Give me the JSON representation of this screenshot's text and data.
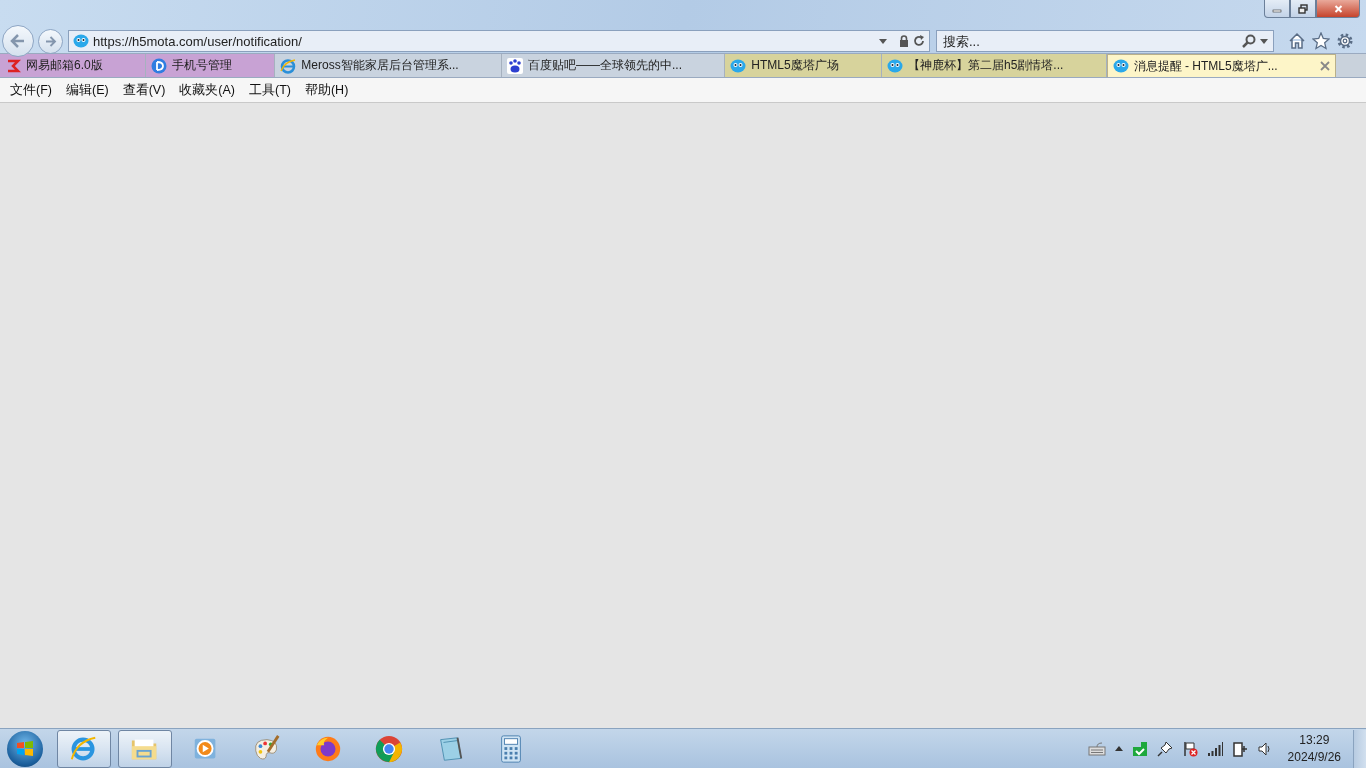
{
  "address_bar": {
    "url": "https://h5mota.com/user/notification/"
  },
  "search": {
    "placeholder": "搜索..."
  },
  "tabs": [
    {
      "label": "网易邮箱6.0版",
      "color": "#c8a2d4",
      "selected": false
    },
    {
      "label": "手机号管理",
      "color": "#c8a2d4",
      "selected": false
    },
    {
      "label": "Meross智能家居后台管理系...",
      "color": "#c9d3df",
      "selected": false
    },
    {
      "label": "百度贴吧——全球领先的中...",
      "color": "#c9d3df",
      "selected": false
    },
    {
      "label": "HTML5魔塔广场",
      "color": "#d7d39c",
      "selected": false
    },
    {
      "label": "【神鹿杯】第二届h5剧情塔...",
      "color": "#d7d39c",
      "selected": false
    },
    {
      "label": "消息提醒 - HTML5魔塔广...",
      "color": "#fdf5c8",
      "selected": true
    }
  ],
  "menu": [
    "文件(F)",
    "编辑(E)",
    "查看(V)",
    "收藏夹(A)",
    "工具(T)",
    "帮助(H)"
  ],
  "taskbar": {
    "apps": [
      {
        "kind": "browser",
        "running": true
      },
      {
        "kind": "folder",
        "running": true
      },
      {
        "kind": "media",
        "running": false
      },
      {
        "kind": "paint",
        "running": false
      },
      {
        "kind": "firefox",
        "running": false
      },
      {
        "kind": "chrome",
        "running": false
      },
      {
        "kind": "notepad",
        "running": false
      },
      {
        "kind": "calculator",
        "running": false
      }
    ],
    "time": "13:29",
    "date": "2024/9/26"
  }
}
